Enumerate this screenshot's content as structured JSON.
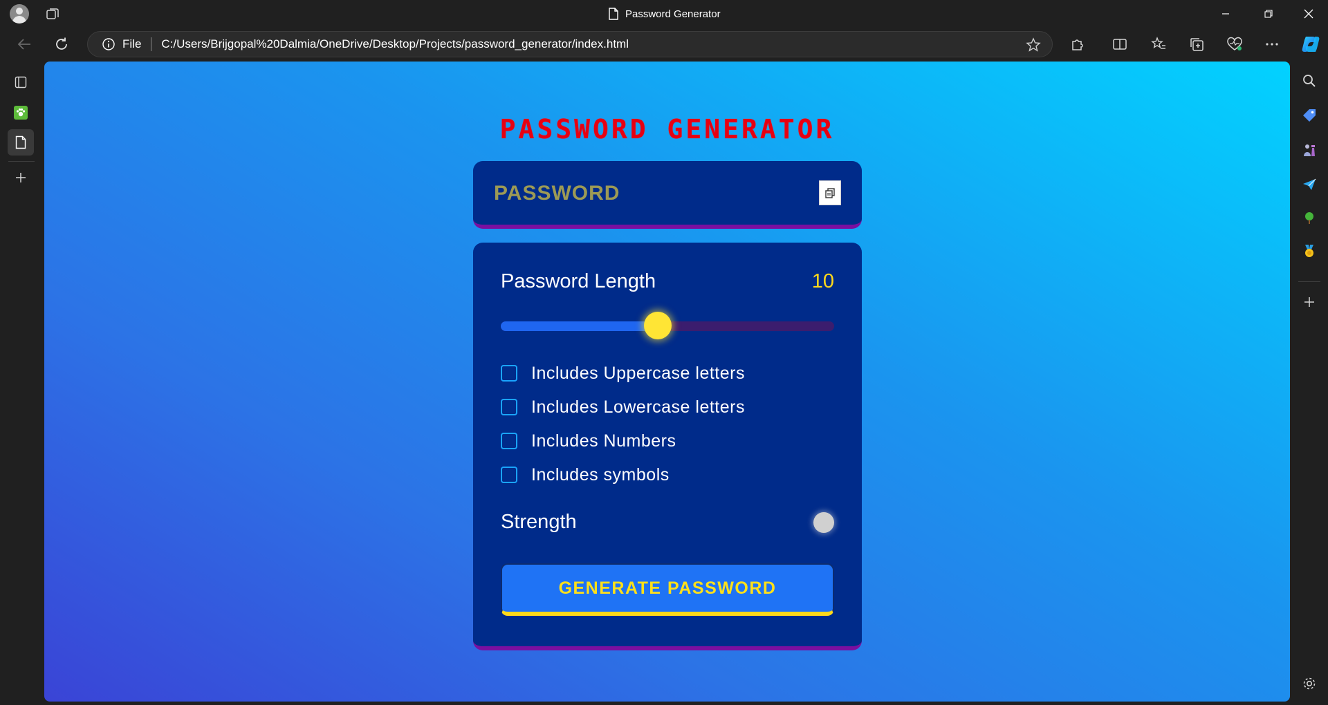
{
  "browser": {
    "tab_title": "Password Generator",
    "address": {
      "scheme_label": "File",
      "url": "C:/Users/Brijgopal%20Dalmia/OneDrive/Desktop/Projects/password_generator/index.html"
    }
  },
  "app": {
    "title": "Password Generator",
    "password_placeholder": "PASSWORD",
    "length": {
      "label": "Password Length",
      "value": "10",
      "fraction": 0.47
    },
    "options": [
      {
        "label": "Includes Uppercase letters",
        "checked": false
      },
      {
        "label": "Includes Lowercase letters",
        "checked": false
      },
      {
        "label": "Includes Numbers",
        "checked": false
      },
      {
        "label": "Includes symbols",
        "checked": false
      }
    ],
    "strength_label": "Strength",
    "generate_label": "Generate Password"
  },
  "colors": {
    "title": "#e60012",
    "panel": "#002b8a",
    "accent_yellow": "#ffd91a",
    "checkbox_border": "#1aa4ff",
    "button": "#1f73f5"
  }
}
